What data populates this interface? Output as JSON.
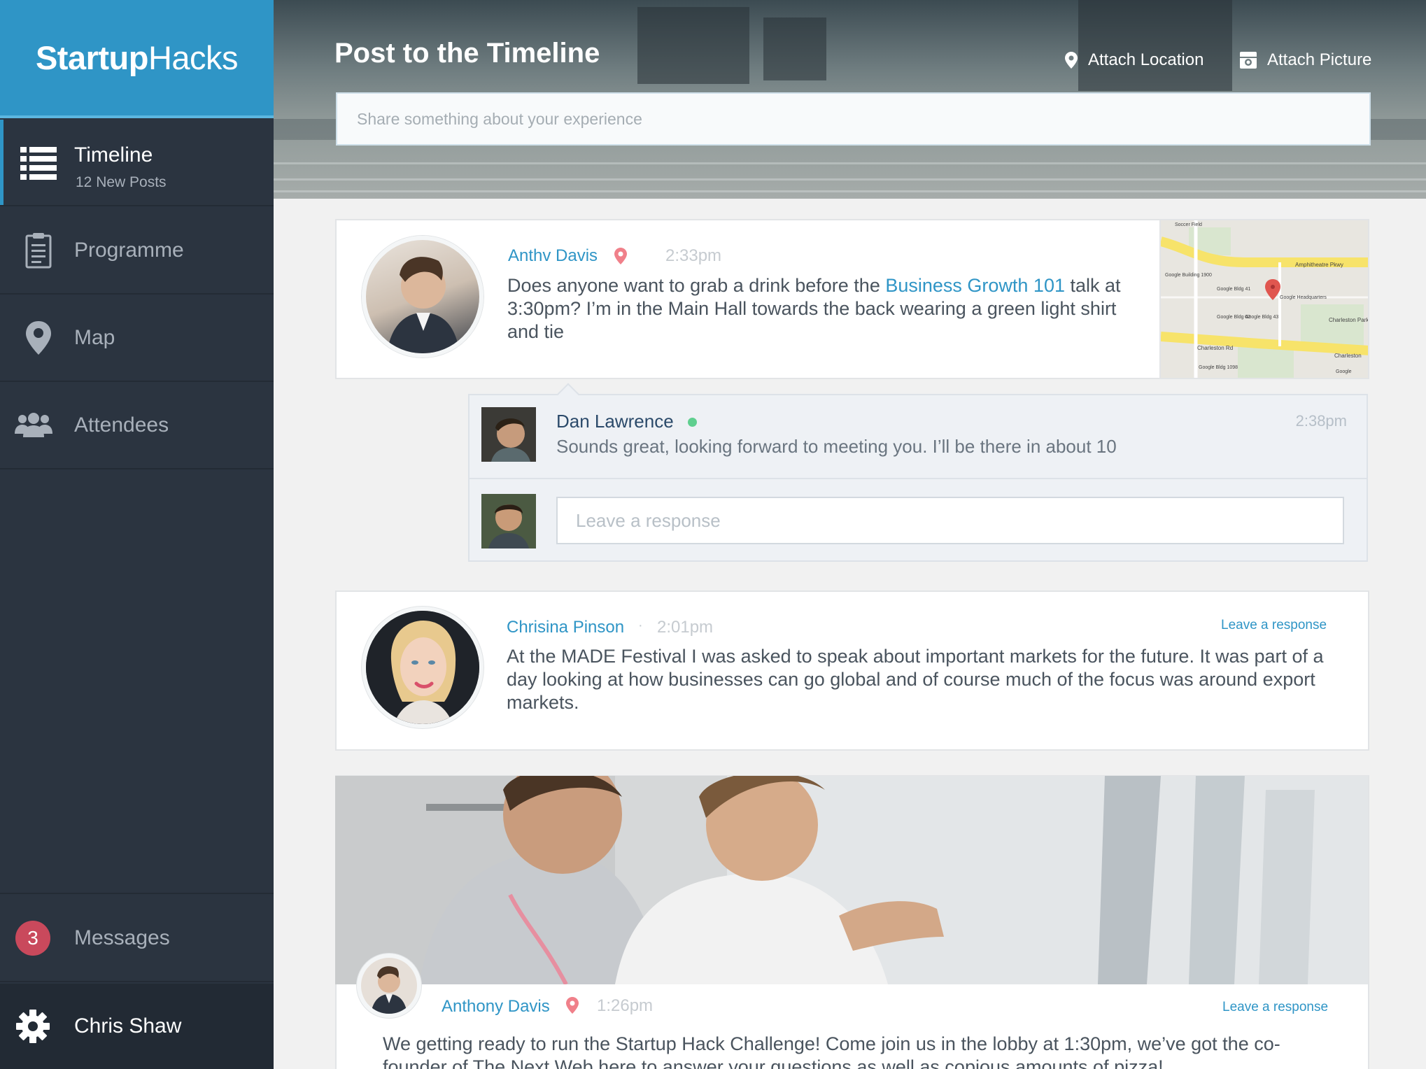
{
  "app": {
    "brand_bold": "Startup",
    "brand_light": "Hacks"
  },
  "sidebar": {
    "items": [
      {
        "label": "Timeline",
        "sub": "12 New Posts",
        "icon": "list-icon"
      },
      {
        "label": "Programme",
        "icon": "clipboard-icon"
      },
      {
        "label": "Map",
        "icon": "map-pin-icon"
      },
      {
        "label": "Attendees",
        "icon": "people-icon"
      }
    ],
    "messages": {
      "label": "Messages",
      "count": "3"
    },
    "user": {
      "name": "Chris Shaw",
      "icon": "gear-icon"
    }
  },
  "header": {
    "title": "Post to the Timeline",
    "attach_location": "Attach Location",
    "attach_picture": "Attach Picture",
    "post_placeholder": "Share something about your experience"
  },
  "posts": [
    {
      "author": "Anthv Davis",
      "time": "2:33pm",
      "text_before": "Does anyone want to grab a drink before the ",
      "link": "Business Growth 101",
      "text_after": " talk at 3:30pm? I’m in the Main Hall towards the back wearing a green light shirt and tie",
      "map_labels": [
        "Amphitheatre Pkwy",
        "Charleston Rd",
        "Charleston Park",
        "Charleston",
        "Google Headquarters",
        "Soccer Field",
        "Google Bldg 41",
        "Google Bldg 42",
        "Google Bldg 43",
        "Google Building 1900",
        "Google Bldg 1098",
        "Google"
      ],
      "reply": {
        "author": "Dan Lawrence",
        "time": "2:38pm",
        "text": "Sounds great, looking forward to meeting you. I’ll be there in about 10"
      },
      "response_placeholder": "Leave a response"
    },
    {
      "author": "Chrisina Pinson",
      "separator": "·",
      "time": "2:01pm",
      "leave_response": "Leave a response",
      "text": "At the MADE Festival I was asked to speak about important markets for the future. It was part of a day looking at how businesses can go global and of course much of the focus was around export markets."
    },
    {
      "author": "Anthony Davis",
      "time": "1:26pm",
      "leave_response": "Leave a response",
      "text": "We getting ready to run the Startup Hack Challenge! Come join us in the lobby at 1:30pm, we’ve got the co-founder of The Next Web here to answer your questions as well as copious amounts of pizza!"
    }
  ],
  "colors": {
    "brand": "#2f95c6",
    "sidebar": "#2b3440",
    "badge": "#c9495c",
    "online": "#5fcf8f",
    "pin": "#f0808a"
  }
}
